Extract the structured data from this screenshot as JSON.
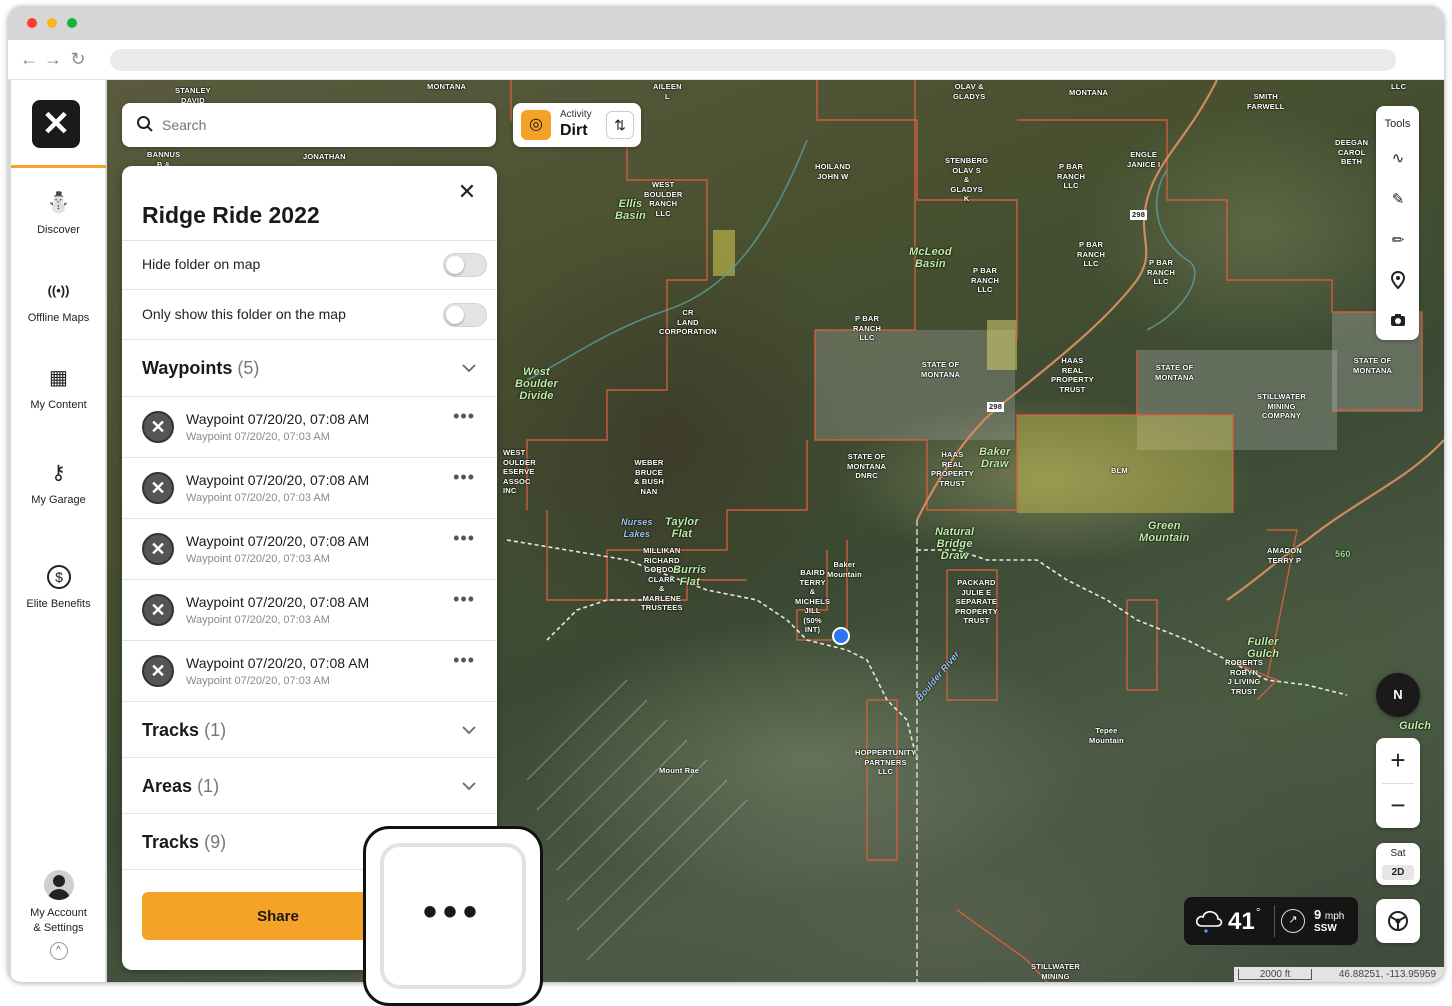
{
  "search": {
    "placeholder": "Search"
  },
  "activity": {
    "label": "Activity",
    "value": "Dirt"
  },
  "rail": {
    "items": [
      {
        "label": "Discover"
      },
      {
        "label": "Offline Maps"
      },
      {
        "label": "My Content"
      },
      {
        "label": "My Garage"
      },
      {
        "label": "Elite Benefits"
      }
    ],
    "account_line1": "My Account",
    "account_line2": "& Settings"
  },
  "panel": {
    "title": "Ridge Ride 2022",
    "hide_folder": "Hide folder on map",
    "only_show": "Only show this folder on the map",
    "sections": [
      {
        "title": "Waypoints",
        "count": "(5)"
      },
      {
        "title": "Tracks",
        "count": "(1)"
      },
      {
        "title": "Areas",
        "count": "(1)"
      },
      {
        "title": "Tracks",
        "count": "(9)"
      }
    ],
    "waypoints": [
      {
        "title": "Waypoint 07/20/20, 07:08 AM",
        "subtitle": "Waypoint 07/20/20, 07:03 AM"
      },
      {
        "title": "Waypoint 07/20/20, 07:08 AM",
        "subtitle": "Waypoint 07/20/20, 07:03 AM"
      },
      {
        "title": "Waypoint 07/20/20, 07:08 AM",
        "subtitle": "Waypoint 07/20/20, 07:03 AM"
      },
      {
        "title": "Waypoint 07/20/20, 07:08 AM",
        "subtitle": "Waypoint 07/20/20, 07:03 AM"
      },
      {
        "title": "Waypoint 07/20/20, 07:08 AM",
        "subtitle": "Waypoint 07/20/20, 07:03 AM"
      }
    ],
    "share_label": "Share"
  },
  "tools": {
    "title": "Tools"
  },
  "compass": {
    "label": "N"
  },
  "layer": {
    "type": "Sat",
    "mode": "2D"
  },
  "weather": {
    "temp": "41",
    "deg": "°",
    "wind_speed": "9",
    "wind_unit": "mph",
    "wind_dir": "SSW"
  },
  "scale": {
    "distance": "2000 ft",
    "coords": "46.88251, -113.95959"
  },
  "map_labels": [
    "STANLEY\nDAVID",
    "MONTANA",
    "AILEEN\nL",
    "OLAV &\nGLADYS",
    "MONTANA",
    "SMITH\nFARWELL",
    "LLC",
    "BANNUS\nB &",
    "JONATHAN",
    "HOILAND\nJOHN W",
    "STENBERG\nOLAV S\n&\nGLADYS\nK",
    "P BAR\nRANCH\nLLC",
    "ENGLE\nJANICE I",
    "DEEGAN\nCAROL\nBETH",
    "WEST\nBOULDER\nRANCH\nLLC",
    "P BAR\nRANCH\nLLC",
    "P BAR\nRANCH\nLLC",
    "P BAR\nRANCH\nLLC",
    "CR\nLAND\nCORPORATION",
    "P BAR\nRANCH\nLLC",
    "STATE OF\nMONTANA",
    "HAAS\nREAL\nPROPERTY\nTRUST",
    "STATE OF\nMONTANA",
    "STILLWATER\nMINING\nCOMPANY",
    "STATE OF\nMONTANA",
    "WEST\nOULDER\nESERVE\nASSOC\nINC",
    "WEBER\nBRUCE\n& BUSH\nNAN",
    "STATE OF\nMONTANA\nDNRC",
    "HAAS\nREAL\nPROPERTY\nTRUST",
    "BLM",
    "MILLIKAN\nRICHARD\nGORDON\nCLARK\n&\nMARLENE\nTRUSTEES",
    "BAIRD\nTERRY\n&\nMICHELS\nJILL\n(50%\nINT)",
    "Baker\nMountain",
    "PACKARD\nJULIE E\nSEPARATE\nPROPERTY\nTRUST",
    "AMADON\nTERRY P",
    "560",
    "ROBERTS\nROBYN\nJ LIVING\nTRUST",
    "Tepee\nMountain",
    "Mount Rae",
    "HOPPERTUNITY\nPARTNERS\nLLC",
    "STILLWATER\nMINING\nCOMPANY",
    "Gulch",
    "298",
    "298"
  ],
  "map_places": [
    "Ellis\nBasin",
    "McLeod\nBasin",
    "West\nBoulder\nDivide",
    "Taylor\nFlat",
    "Nurses\nLakes",
    "Burris\nFlat",
    "Baker\nDraw",
    "Natural\nBridge\nDraw",
    "Green\nMountain",
    "Fuller\nGulch",
    "Boulder River"
  ]
}
